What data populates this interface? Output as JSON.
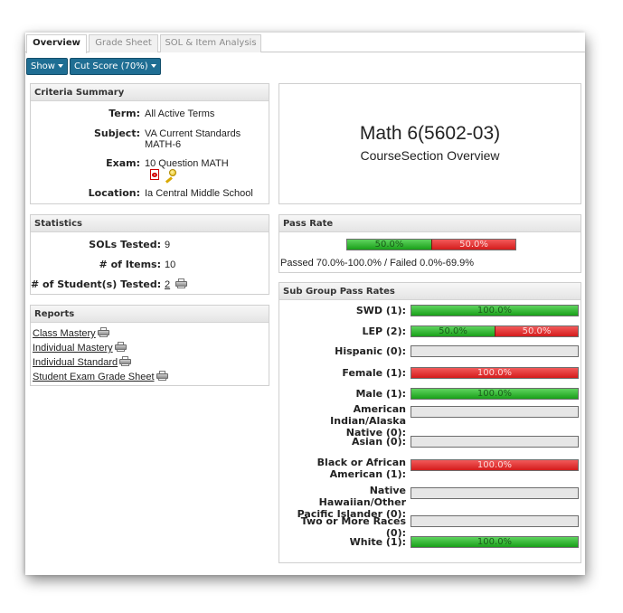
{
  "tabs": [
    {
      "label": "Overview",
      "active": true
    },
    {
      "label": "Grade Sheet",
      "active": false
    },
    {
      "label": "SOL & Item Analysis",
      "active": false
    }
  ],
  "toolbar": {
    "show_label": "Show",
    "cut_score_label": "Cut Score (70%)"
  },
  "criteria": {
    "header": "Criteria Summary",
    "term_label": "Term:",
    "term_value": "All Active Terms",
    "subject_label": "Subject:",
    "subject_value_line1": "VA Current Standards",
    "subject_value_line2": "MATH-6",
    "exam_label": "Exam:",
    "exam_value": "10 Question MATH",
    "location_label": "Location:",
    "location_value": "Ia Central Middle School"
  },
  "overview": {
    "title": "Math 6(5602-03)",
    "subtitle": "CourseSection Overview"
  },
  "statistics": {
    "header": "Statistics",
    "sols_label": "SOLs Tested:",
    "sols_value": "9",
    "items_label": "# of Items:",
    "items_value": "10",
    "students_label": "# of Student(s) Tested:",
    "students_value": "2"
  },
  "reports": {
    "header": "Reports",
    "links": [
      "Class Mastery",
      "Individual Mastery",
      "Individual Standard",
      "Student Exam Grade Sheet"
    ]
  },
  "pass_rate": {
    "header": "Pass Rate",
    "passed_pct": 50.0,
    "failed_pct": 50.0,
    "passed_label": "50.0%",
    "failed_label": "50.0%",
    "caption": "Passed 70.0%-100.0% / Failed 0.0%-69.9%"
  },
  "subgroups": {
    "header": "Sub Group Pass Rates",
    "rows": [
      {
        "label": "SWD (1):",
        "label2": "",
        "pass": 100,
        "fail": 0,
        "pass_label": "100.0%",
        "fail_label": ""
      },
      {
        "label": "LEP (2):",
        "label2": "",
        "pass": 50,
        "fail": 50,
        "pass_label": "50.0%",
        "fail_label": "50.0%"
      },
      {
        "label": "Hispanic (0):",
        "label2": "",
        "pass": 0,
        "fail": 0,
        "pass_label": "",
        "fail_label": ""
      },
      {
        "label": "Female (1):",
        "label2": "",
        "pass": 0,
        "fail": 100,
        "pass_label": "",
        "fail_label": "100.0%"
      },
      {
        "label": "Male (1):",
        "label2": "",
        "pass": 100,
        "fail": 0,
        "pass_label": "100.0%",
        "fail_label": ""
      },
      {
        "label": "American Indian/Alaska",
        "label2": "Native (0):",
        "pass": 0,
        "fail": 0,
        "pass_label": "",
        "fail_label": ""
      },
      {
        "label": "Asian (0):",
        "label2": "",
        "pass": 0,
        "fail": 0,
        "pass_label": "",
        "fail_label": ""
      },
      {
        "label": "Black or African",
        "label2": "American (1):",
        "pass": 0,
        "fail": 100,
        "pass_label": "",
        "fail_label": "100.0%"
      },
      {
        "label": "Native Hawaiian/Other",
        "label2": "Pacific Islander (0):",
        "pass": 0,
        "fail": 0,
        "pass_label": "",
        "fail_label": ""
      },
      {
        "label": "Two or More Races (0):",
        "label2": "",
        "pass": 0,
        "fail": 0,
        "pass_label": "",
        "fail_label": ""
      },
      {
        "label": "White (1):",
        "label2": "",
        "pass": 100,
        "fail": 0,
        "pass_label": "100.0%",
        "fail_label": ""
      }
    ]
  },
  "colors": {
    "pass": "#19a019",
    "fail": "#d41c1c",
    "empty": "#e6e6e6",
    "button": "#1f6e93"
  }
}
